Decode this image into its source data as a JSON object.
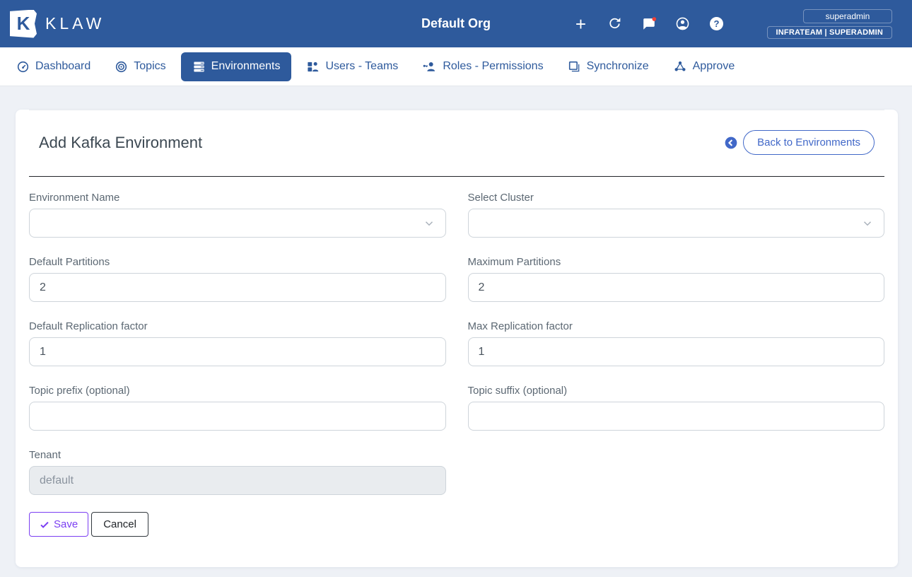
{
  "header": {
    "brand": "KLAW",
    "logo_letter": "K",
    "org_title": "Default Org",
    "user": {
      "name": "superadmin",
      "team_role": "INFRATEAM | SUPERADMIN"
    },
    "icons": [
      "plus",
      "refresh",
      "chat-notification",
      "account",
      "help"
    ]
  },
  "nav": {
    "items": [
      {
        "label": "Dashboard",
        "icon": "dashboard-gauge",
        "active": false
      },
      {
        "label": "Topics",
        "icon": "target",
        "active": false
      },
      {
        "label": "Environments",
        "icon": "server-stack",
        "active": true
      },
      {
        "label": "Users - Teams",
        "icon": "user-grid",
        "active": false
      },
      {
        "label": "Roles - Permissions",
        "icon": "person-key",
        "active": false
      },
      {
        "label": "Synchronize",
        "icon": "overlap-squares",
        "active": false
      },
      {
        "label": "Approve",
        "icon": "hub-network",
        "active": false
      }
    ]
  },
  "main": {
    "title": "Add Kafka Environment",
    "back_button_label": "Back to Environments",
    "form": {
      "fields": [
        {
          "label": "Environment Name",
          "type": "select",
          "value": ""
        },
        {
          "label": "Select Cluster",
          "type": "select",
          "value": ""
        },
        {
          "label": "Default Partitions",
          "type": "text",
          "value": "2"
        },
        {
          "label": "Maximum Partitions",
          "type": "text",
          "value": "2"
        },
        {
          "label": "Default Replication factor",
          "type": "text",
          "value": "1"
        },
        {
          "label": "Max Replication factor",
          "type": "text",
          "value": "1"
        },
        {
          "label": "Topic prefix (optional)",
          "type": "text",
          "value": ""
        },
        {
          "label": "Topic suffix (optional)",
          "type": "text",
          "value": ""
        },
        {
          "label": "Tenant",
          "type": "text",
          "value": "",
          "placeholder": "default",
          "disabled": true
        }
      ],
      "save_label": "Save",
      "cancel_label": "Cancel"
    }
  },
  "colors": {
    "header_blue": "#2e5a9c",
    "page_bg": "#eef1f6",
    "back_button_blue": "#4168c8",
    "save_purple": "#7b3ff2",
    "notification_red": "#ef4136",
    "input_border": "#ced4da",
    "disabled_bg": "#e9ecef"
  }
}
